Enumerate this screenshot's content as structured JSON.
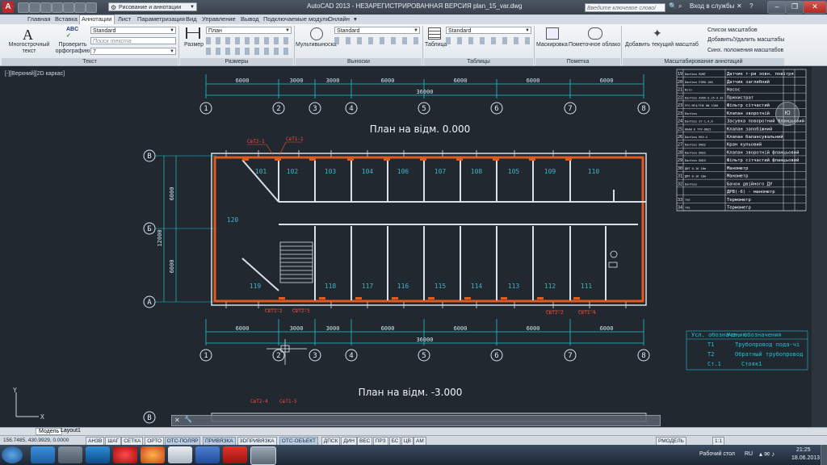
{
  "window": {
    "title": "AutoCAD 2013 - НЕЗАРЕГИСТРИРОВАННАЯ ВЕРСИЯ    plan_15_var.dwg",
    "workspace": "Рисование и аннотации",
    "search_placeholder": "Введите ключевое слово/фразу",
    "signin": "Вход в службы"
  },
  "menu_tabs": [
    "Главная",
    "Вставка",
    "Аннотации",
    "Лист",
    "Параметризация",
    "Вид",
    "Управление",
    "Вывод",
    "Подключаемые модули",
    "Онлайн"
  ],
  "ribbon": {
    "text_panel": {
      "mtext": "Многострочный текст",
      "spell": "Проверить орфографию",
      "style": "Standard",
      "find_placeholder": "Поиск текста",
      "height": "7",
      "title": "Текст"
    },
    "dims_panel": {
      "dim": "Размер",
      "style": "План",
      "title": "Размеры"
    },
    "leaders_panel": {
      "multileader": "Мультивыноска",
      "style": "Standard",
      "title": "Выноски"
    },
    "tables_panel": {
      "table": "Таблица",
      "style": "Standard",
      "title": "Таблицы"
    },
    "markup_panel": {
      "wipeout": "Маскировка",
      "revcloud": "Пометочное облако",
      "title": "Пометка"
    },
    "scale_panel": {
      "add_current": "Добавить текущий масштаб",
      "list": "Список масштабов",
      "add_remove": "Добавить/Удалить масштабы",
      "sync": "Синх. положения масштабов",
      "title": "Масштабирование аннотаций"
    }
  },
  "viewport": {
    "label": "[-][Верхний][2D каркас]"
  },
  "drawing": {
    "plan1_title": "План на відм. 0.000",
    "plan2_title": "План на відм. -3.000",
    "axes": [
      "1",
      "2",
      "3",
      "4",
      "5",
      "6",
      "7",
      "8"
    ],
    "row_axes": [
      "В",
      "Б",
      "А"
    ],
    "dims_top": [
      "6000",
      "3000",
      "3000",
      "6000",
      "6000",
      "6000",
      "6000"
    ],
    "total": "36000",
    "dims_left": [
      "6000",
      "6000"
    ],
    "total_left": "12000",
    "rooms_top": [
      "101",
      "102",
      "103",
      "104",
      "106",
      "107",
      "108",
      "105",
      "109",
      "110"
    ],
    "room_hall": "120",
    "rooms_bottom": [
      "119",
      "118",
      "117",
      "116",
      "115",
      "114",
      "113",
      "112",
      "111"
    ],
    "pipes": [
      "СвТ2-1",
      "СвТ1-1",
      "СвТ1-2",
      "СвТ2-3",
      "СвТ2-2",
      "СвТ1-4"
    ],
    "pipes_lower": [
      "СвТ2-4",
      "СвТ1-5"
    ]
  },
  "spec_table": {
    "rows": [
      {
        "pos": "19",
        "mark": "Danfoss RDNT",
        "name": "Датчик т-ри зовн. повітря"
      },
      {
        "pos": "20",
        "mark": "Danfoss ESMU-100",
        "name": "Датчик заглибний"
      },
      {
        "pos": "21",
        "mark": "Wilo",
        "name": "Насос"
      },
      {
        "pos": "22",
        "mark": "Danfoss AVDO-d.25-d.32",
        "name": "Прихистрат"
      },
      {
        "pos": "23",
        "mark": "FFG MF4/THE DN 1300",
        "name": "Фільтр сітчастий"
      },
      {
        "pos": "23",
        "mark": "Danfoss",
        "name": "Клапан зворотній"
      },
      {
        "pos": "24",
        "mark": "Danfoss ST-1,4,6",
        "name": "Засувка поворотний фланцьовий"
      },
      {
        "pos": "25",
        "mark": "KRAN K TTP-DN25",
        "name": "Клапан запобіжний"
      },
      {
        "pos": "26",
        "mark": "Danfoss MSV-S",
        "name": "Клапан балансувальний"
      },
      {
        "pos": "27",
        "mark": "Danfoss DN32",
        "name": "Кран кульовий"
      },
      {
        "pos": "28",
        "mark": "Danfoss DN32",
        "name": "Клапан зворотній фланцьовий"
      },
      {
        "pos": "29",
        "mark": "Danfoss DN25",
        "name": "Фільтр сітчастий фланцьовий"
      },
      {
        "pos": "30",
        "mark": "ДМТ 0-16 10м",
        "name": "Манометр"
      },
      {
        "pos": "31",
        "mark": "ДМТ 0-16 10м",
        "name": "Манометр"
      },
      {
        "pos": "32",
        "mark": "Danfoss",
        "name": "Бачок двійного ДУ"
      },
      {
        "pos": "",
        "mark": "",
        "name": "ДРВ(-6) - манометр"
      },
      {
        "pos": "33",
        "mark": "ТУЕ",
        "name": "Термометр"
      },
      {
        "pos": "34",
        "mark": "ТУЕ",
        "name": "Термометр"
      }
    ]
  },
  "legend": {
    "title": "Усл. обозначения",
    "rows": [
      {
        "sym": "Т1",
        "text": "Трубопровод пода-чі"
      },
      {
        "sym": "Т2",
        "text": "Обратный трубопровод"
      },
      {
        "sym": "Ст.1",
        "text": "Стояк1"
      }
    ]
  },
  "layout_tabs": [
    "Модель",
    "Layout1"
  ],
  "status": {
    "coords": "156.7485, 430.9929, 0.0000",
    "toggles": [
      "АНЗВ",
      "ШАГ",
      "СЕТКА",
      "ОРТО",
      "ОТС-ПОЛЯР",
      "ПРИВЯЗКА",
      "3DПРИВЯЗКА",
      "ОТС-ОБЪЕКТ",
      "ДПСК",
      "ДИН",
      "ВЕС",
      "ПРЗ",
      "БС",
      "ЦВ",
      "АМ"
    ],
    "on_indices": [
      4,
      5,
      7
    ],
    "model": "РМОДЕЛЬ",
    "scale": "1:1"
  },
  "taskbar": {
    "desktop": "Рабочий стол",
    "lang": "RU",
    "time": "21:25",
    "date": "18.06.2013"
  },
  "colors": {
    "wall": "#d9dfe6",
    "hatch": "#e15a1f",
    "dim": "#1fc4d6",
    "axis": "#9ad7f0",
    "red": "#ff3a3a"
  }
}
